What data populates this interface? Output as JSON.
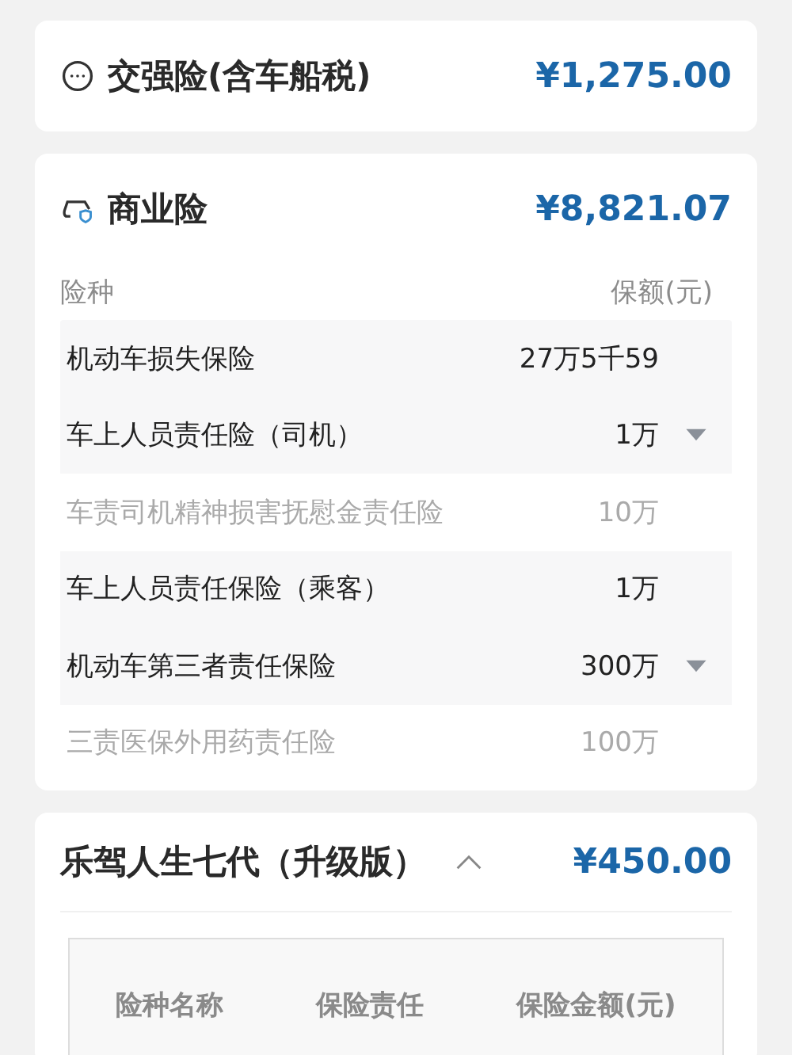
{
  "compulsory": {
    "title": "交强险(含车船税)",
    "price": "¥1,275.00"
  },
  "commercial": {
    "title": "商业险",
    "price": "¥8,821.07",
    "columns": [
      "险种",
      "保额(元)"
    ],
    "rows": [
      {
        "name": "机动车损失保险",
        "amount": "27万5千59",
        "kind": "plain",
        "disabled": false
      },
      {
        "name": "车上人员责任险（司机）",
        "amount": "1万",
        "kind": "select",
        "disabled": false
      },
      {
        "name": "车责司机精神损害抚慰金责任险",
        "amount": "10万",
        "kind": "plain",
        "disabled": true
      },
      {
        "name": "车上人员责任保险（乘客）",
        "amount": "1万",
        "kind": "plain",
        "disabled": false
      },
      {
        "name": "机动车第三者责任保险",
        "amount": "300万",
        "kind": "select",
        "disabled": false
      },
      {
        "name": "三责医保外用药责任险",
        "amount": "100万",
        "kind": "plain",
        "disabled": true
      }
    ]
  },
  "addon": {
    "title": "乐驾人生七代（升级版）",
    "expanded": true,
    "price": "¥450.00",
    "columns": [
      "险种名称",
      "保险责任",
      "保险金额(元)"
    ]
  }
}
